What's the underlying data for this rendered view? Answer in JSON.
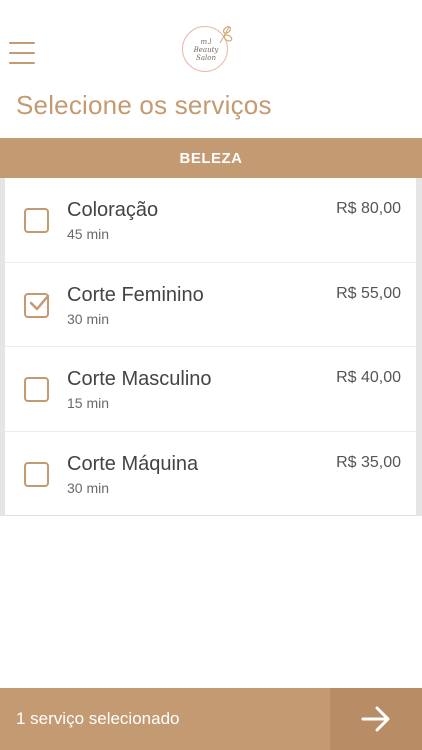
{
  "header": {
    "logo_text": [
      "m.l",
      "Beauty",
      "Salon"
    ]
  },
  "page_title": "Selecione os serviços",
  "category": "BELEZA",
  "services": [
    {
      "name": "Coloração",
      "duration": "45 min",
      "price": "R$ 80,00",
      "checked": false
    },
    {
      "name": "Corte Feminino",
      "duration": "30 min",
      "price": "R$ 55,00",
      "checked": true
    },
    {
      "name": "Corte Masculino",
      "duration": "15 min",
      "price": "R$ 40,00",
      "checked": false
    },
    {
      "name": "Corte Máquina",
      "duration": "30 min",
      "price": "R$ 35,00",
      "checked": false
    }
  ],
  "footer": {
    "status": "1 serviço selecionado"
  },
  "colors": {
    "accent": "#c49a72",
    "accent_dark": "#b88d65",
    "logo_ring": "#e9b8b0"
  },
  "icons": {
    "menu": "hamburger-icon",
    "next": "arrow-right-icon",
    "check": "checkmark-icon"
  }
}
